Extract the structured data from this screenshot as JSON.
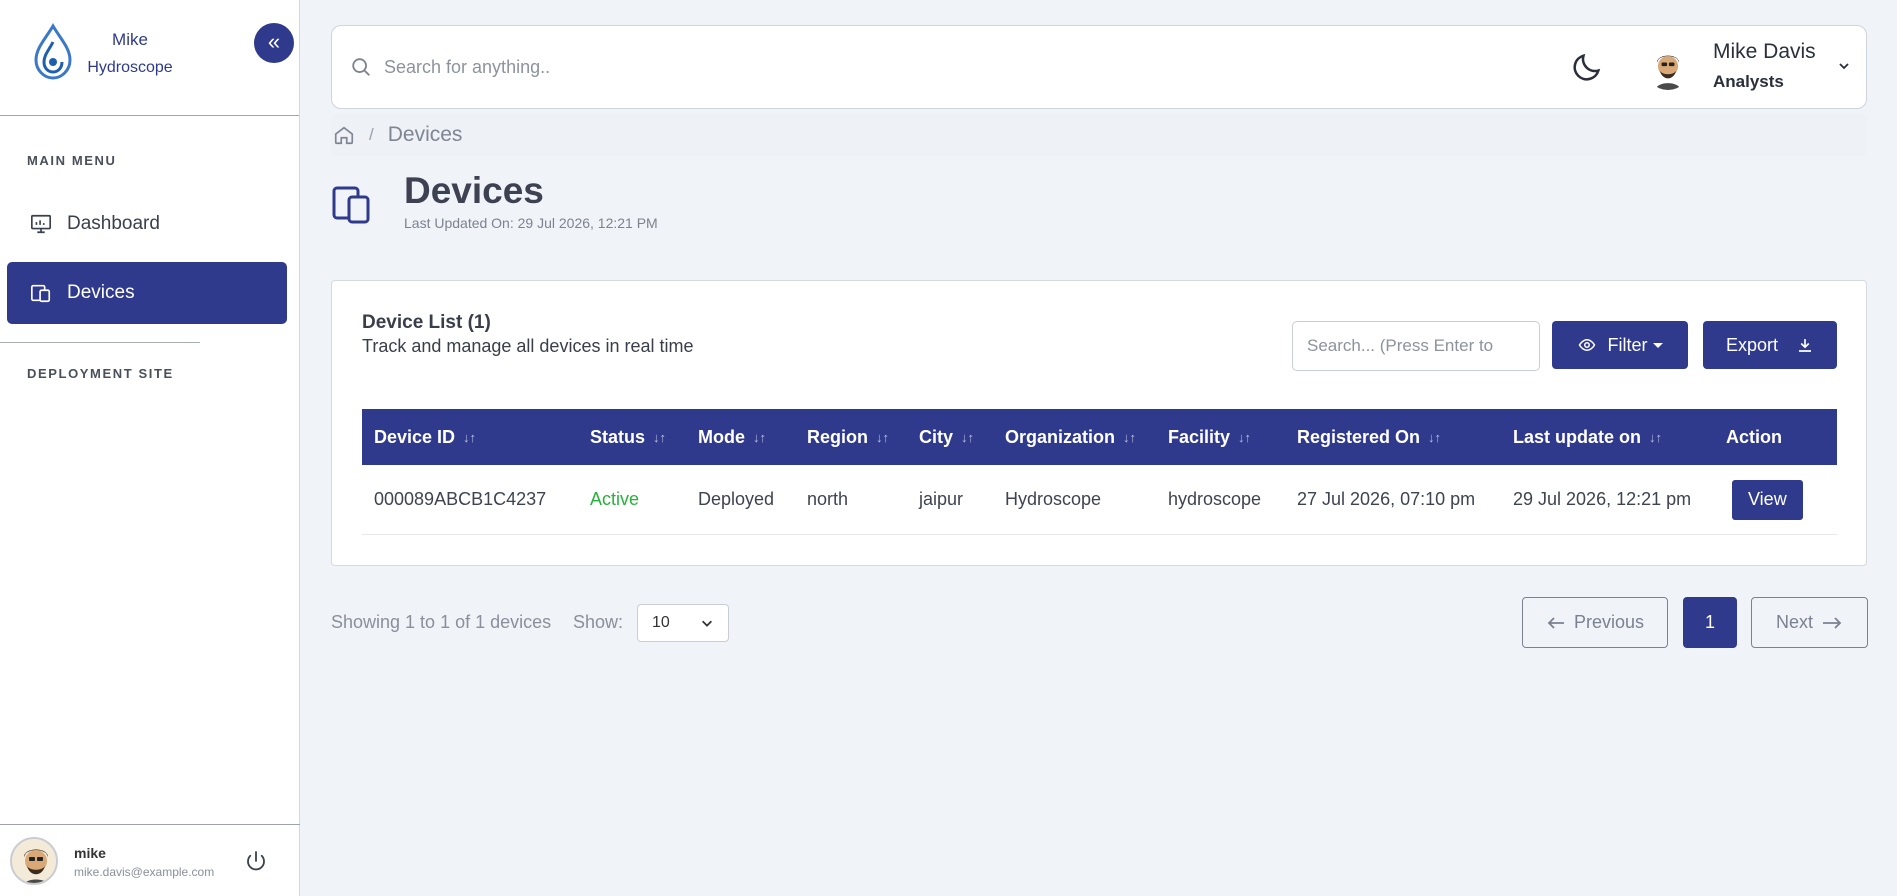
{
  "brand": {
    "name_line1": "Mike",
    "name_line2": "Hydroscope",
    "collapse_icon": "double-chevron-left-icon"
  },
  "sidebar": {
    "main_menu_heading": "MAIN MENU",
    "items": [
      {
        "label": "Dashboard",
        "icon": "monitor-chart-icon",
        "active": false
      },
      {
        "label": "Devices",
        "icon": "devices-icon",
        "active": true
      }
    ],
    "deployment_heading": "DEPLOYMENT SITE",
    "user": {
      "name": "mike",
      "email": "mike.davis@example.com"
    }
  },
  "topbar": {
    "search_placeholder": "Search for anything..",
    "user_name": "Mike Davis",
    "user_role": "Analysts"
  },
  "breadcrumb": {
    "separator": "/",
    "current": "Devices"
  },
  "page": {
    "title": "Devices",
    "last_updated": "Last Updated On: 29 Jul 2026, 12:21 PM"
  },
  "card": {
    "title": "Device List (1)",
    "subtitle": "Track and manage all devices in real time",
    "search_placeholder": "Search... (Press Enter to",
    "filter_label": "Filter",
    "export_label": "Export"
  },
  "table": {
    "columns": [
      "Device ID",
      "Status",
      "Mode",
      "Region",
      "City",
      "Organization",
      "Facility",
      "Registered On",
      "Last update on",
      "Action"
    ],
    "sort_glyph": "↓↑",
    "rows": [
      {
        "device_id": "000089ABCB1C4237",
        "status": "Active",
        "mode": "Deployed",
        "region": "north",
        "city": "jaipur",
        "organization": "Hydroscope",
        "facility": "hydroscope",
        "registered_on": "27 Jul 2026, 07:10 pm",
        "last_update": "29 Jul 2026, 12:21 pm",
        "action": "View"
      }
    ]
  },
  "pagination": {
    "showing": "Showing 1 to 1 of 1 devices",
    "show_label": "Show:",
    "page_size": "10",
    "previous": "Previous",
    "current_page": "1",
    "next": "Next"
  },
  "colors": {
    "primary": "#2f3a8c",
    "active_status": "#25b339",
    "background": "#f0f3f8"
  }
}
